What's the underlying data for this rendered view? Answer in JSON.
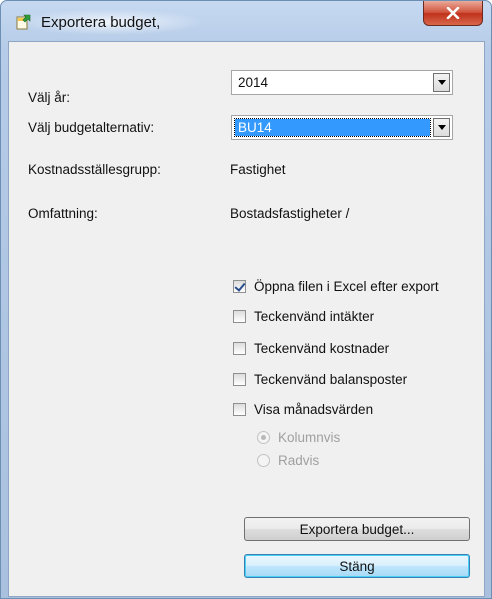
{
  "window": {
    "title": "Exportera budget,",
    "close_label": "X"
  },
  "form": {
    "year_label": "Välj år:",
    "year_value": "2014",
    "budget_alt_label": "Välj budgetalternativ:",
    "budget_alt_value": "BU14",
    "cost_center_group_label": "Kostnadsställesgrupp:",
    "cost_center_group_value": "Fastighet",
    "scope_label": "Omfattning:",
    "scope_value": "Bostadsfastigheter /"
  },
  "options": {
    "checkboxes": [
      {
        "label": "Öppna filen i Excel efter export",
        "checked": true
      },
      {
        "label": "Teckenvänd intäkter",
        "checked": false
      },
      {
        "label": "Teckenvänd kostnader",
        "checked": false
      },
      {
        "label": "Teckenvänd balansposter",
        "checked": false
      },
      {
        "label": "Visa månadsvärden",
        "checked": false
      }
    ],
    "radios": [
      {
        "label": "Kolumnvis",
        "selected": true,
        "enabled": false
      },
      {
        "label": "Radvis",
        "selected": false,
        "enabled": false
      }
    ]
  },
  "buttons": {
    "export_label": "Exportera budget...",
    "close_label": "Stäng"
  },
  "icons": {
    "app": "export-document-icon",
    "close": "close-icon",
    "dropdown": "chevron-down-icon"
  }
}
